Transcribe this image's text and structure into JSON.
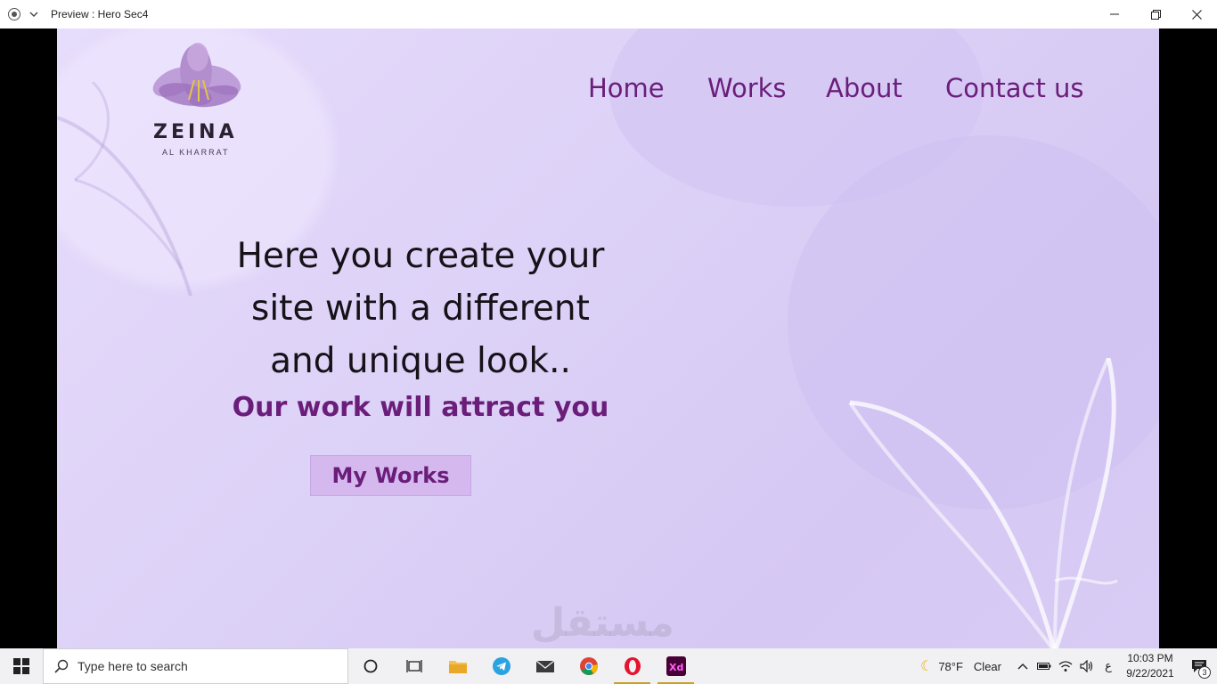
{
  "window": {
    "title": "Preview : Hero Sec4"
  },
  "logo": {
    "name": "ZEINA",
    "subtitle": "AL KHARRAT"
  },
  "nav": {
    "items": [
      {
        "label": "Home"
      },
      {
        "label": "Works"
      },
      {
        "label": "About"
      },
      {
        "label": "Contact us"
      }
    ]
  },
  "hero": {
    "heading_line1": "Here you create your",
    "heading_line2": "site with a different",
    "heading_line3": "and unique look..",
    "subheading": "Our work will attract you",
    "button_label": "My Works"
  },
  "watermark": {
    "text": "مستقل"
  },
  "taskbar": {
    "search_placeholder": "Type here to search",
    "weather_temp": "78°F",
    "weather_desc": "Clear",
    "lang": "ع",
    "time": "10:03 PM",
    "date": "9/22/2021",
    "notification_count": "3"
  },
  "colors": {
    "accent": "#6b1d7a",
    "canvas_bg": "#ddd2f7",
    "button_bg": "#d4b8ee"
  }
}
